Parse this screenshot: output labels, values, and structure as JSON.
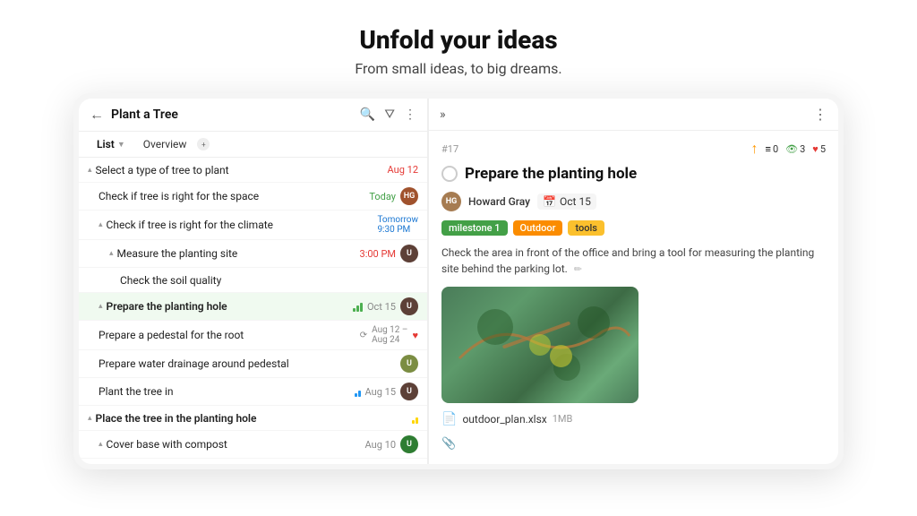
{
  "hero": {
    "title": "Unfold your ideas",
    "subtitle": "From small ideas, to big dreams."
  },
  "app": {
    "left": {
      "title": "Plant a Tree",
      "tabs": [
        {
          "label": "List",
          "active": true,
          "has_arrow": true
        },
        {
          "label": "Overview",
          "active": false
        },
        {
          "label": "+",
          "active": false,
          "is_dot": true
        }
      ],
      "tasks": [
        {
          "id": 1,
          "indent": 0,
          "arrow": true,
          "name": "Select a type of tree to plant",
          "date": "Aug 12",
          "date_color": "red",
          "bold": true
        },
        {
          "id": 2,
          "indent": 1,
          "arrow": false,
          "name": "Check if tree is right for the space",
          "date": "Today",
          "date_color": "green",
          "has_avatar": true,
          "avatar_color": "#a0522d",
          "avatar_text": "HG"
        },
        {
          "id": 3,
          "indent": 1,
          "arrow": true,
          "name": "Check if tree is right for the climate",
          "date": "Tomorrow 9:30 PM",
          "date_color": "blue",
          "bold": false
        },
        {
          "id": 4,
          "indent": 2,
          "arrow": true,
          "name": "Measure the planting site",
          "date": "3:00 PM",
          "date_color": "red",
          "has_avatar": true,
          "avatar_color": "#5d4037",
          "avatar_text": "U"
        },
        {
          "id": 5,
          "indent": 3,
          "arrow": false,
          "name": "Check the soil quality"
        },
        {
          "id": 6,
          "indent": 1,
          "arrow": true,
          "name": "Prepare the planting hole",
          "date_badge": "Oct 15",
          "has_avatar": true,
          "avatar_color": "#5d4037",
          "avatar_text": "U",
          "highlighted": true,
          "has_priority": true,
          "bold": true
        },
        {
          "id": 7,
          "indent": 1,
          "arrow": false,
          "name": "Prepare a pedestal for the root",
          "date": "Aug 12 – Aug 24",
          "has_heart": true,
          "has_sync": true
        },
        {
          "id": 8,
          "indent": 1,
          "arrow": false,
          "name": "Prepare water drainage around pedestal",
          "has_avatar": true,
          "avatar_color": "#7b8d42",
          "avatar_text": "U"
        },
        {
          "id": 9,
          "indent": 1,
          "arrow": false,
          "name": "Plant the tree in",
          "date": "Aug 15",
          "has_priority": true,
          "has_avatar": true,
          "avatar_color": "#5d4037",
          "avatar_text": "U"
        },
        {
          "id": 10,
          "indent": 0,
          "arrow": true,
          "name": "Place the tree in the planting hole",
          "has_priority_yellow": true,
          "bold": true
        },
        {
          "id": 11,
          "indent": 1,
          "arrow": true,
          "name": "Cover base with compost",
          "date": "Aug 10",
          "has_avatar": true,
          "avatar_color": "#2e7d32",
          "avatar_text": "U"
        }
      ]
    },
    "right": {
      "task_num": "#17",
      "stats": {
        "up": {
          "count": 0
        },
        "eye": {
          "count": 3
        },
        "heart": {
          "count": 5
        }
      },
      "task_title": "Prepare the planting hole",
      "assignee": "Howard Gray",
      "due_date": "Oct 15",
      "tags": [
        "milestone 1",
        "Outdoor",
        "tools"
      ],
      "description": "Check the area in front of the office and bring a tool for measuring the planting site behind the parking lot.",
      "file": {
        "name": "outdoor_plan.xlsx",
        "size": "1MB"
      }
    }
  }
}
